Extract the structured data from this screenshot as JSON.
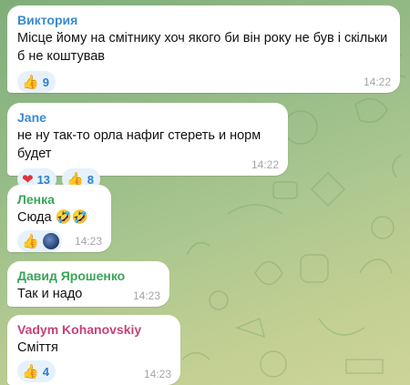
{
  "messages": [
    {
      "author": "Виктория",
      "author_color": "#3a8ad1",
      "text": "Місце йому на смітнику хоч якого би він року не був і скільки б не коштував",
      "reactions": [
        {
          "emoji": "👍",
          "count": "9"
        }
      ],
      "time": "14:22"
    },
    {
      "author": "Jane",
      "author_color": "#3a8ad1",
      "text": "не ну так-то орла нафиг стереть и норм будет",
      "reactions": [
        {
          "emoji": "❤️",
          "count": "13"
        },
        {
          "emoji": "👍",
          "count": "8"
        }
      ],
      "time": "14:22"
    },
    {
      "author": "Ленка",
      "author_color": "#3aa55a",
      "text": "Сюда 🤣🤣",
      "reactions": [
        {
          "emoji": "👍",
          "icon": "reactor-avatar"
        }
      ],
      "time": "14:23"
    },
    {
      "author": "Давид Ярошенко",
      "author_color": "#3aa55a",
      "text": "Так и надо",
      "time": "14:23"
    },
    {
      "author": "Vadym Kohanovskiy",
      "author_color": "#c7417a",
      "text": "Сміття",
      "reactions": [
        {
          "emoji": "👍",
          "count": "4"
        }
      ],
      "time": "14:23"
    }
  ]
}
